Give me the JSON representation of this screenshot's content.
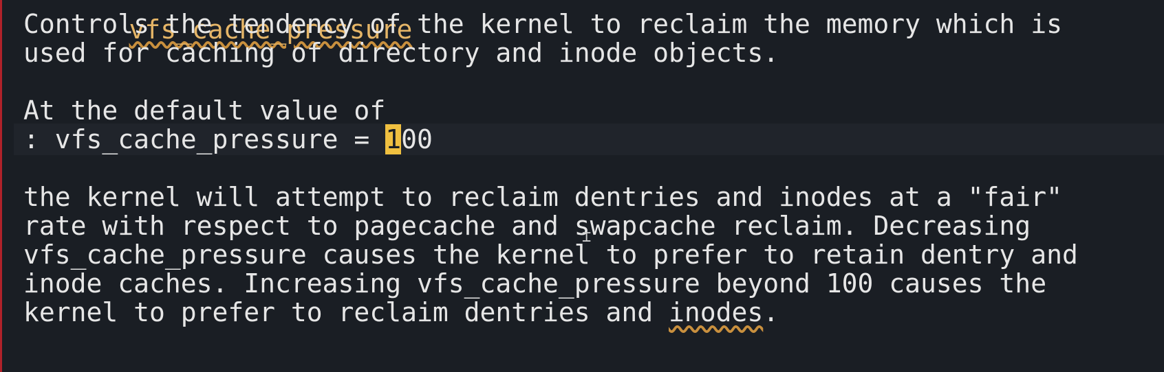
{
  "editor": {
    "heading_fragment": "vfs_cache_pressure",
    "lines": [
      "Controls the tendency of the kernel to reclaim the memory which is",
      "used for caching of directory and inode objects.",
      "",
      "At the default value of",
      "",
      "",
      "the kernel will attempt to reclaim dentries and inodes at a \"fair\"",
      "rate with respect to pagecache and swapcache reclaim. Decreasing",
      "vfs_cache_pressure causes the kernel to prefer to retain dentry and",
      "inode caches. Increasing vfs_cache_pressure beyond 100 causes the"
    ],
    "current_line": {
      "prefix": ": vfs_cache_pressure = ",
      "cursor_char": "1",
      "suffix": "00"
    },
    "last_line": {
      "prefix": "kernel to prefer to reclaim dentries and ",
      "squiggle_word": "inodes",
      "suffix": "."
    },
    "mouse_cursor_icon": "text-cursor-icon"
  }
}
